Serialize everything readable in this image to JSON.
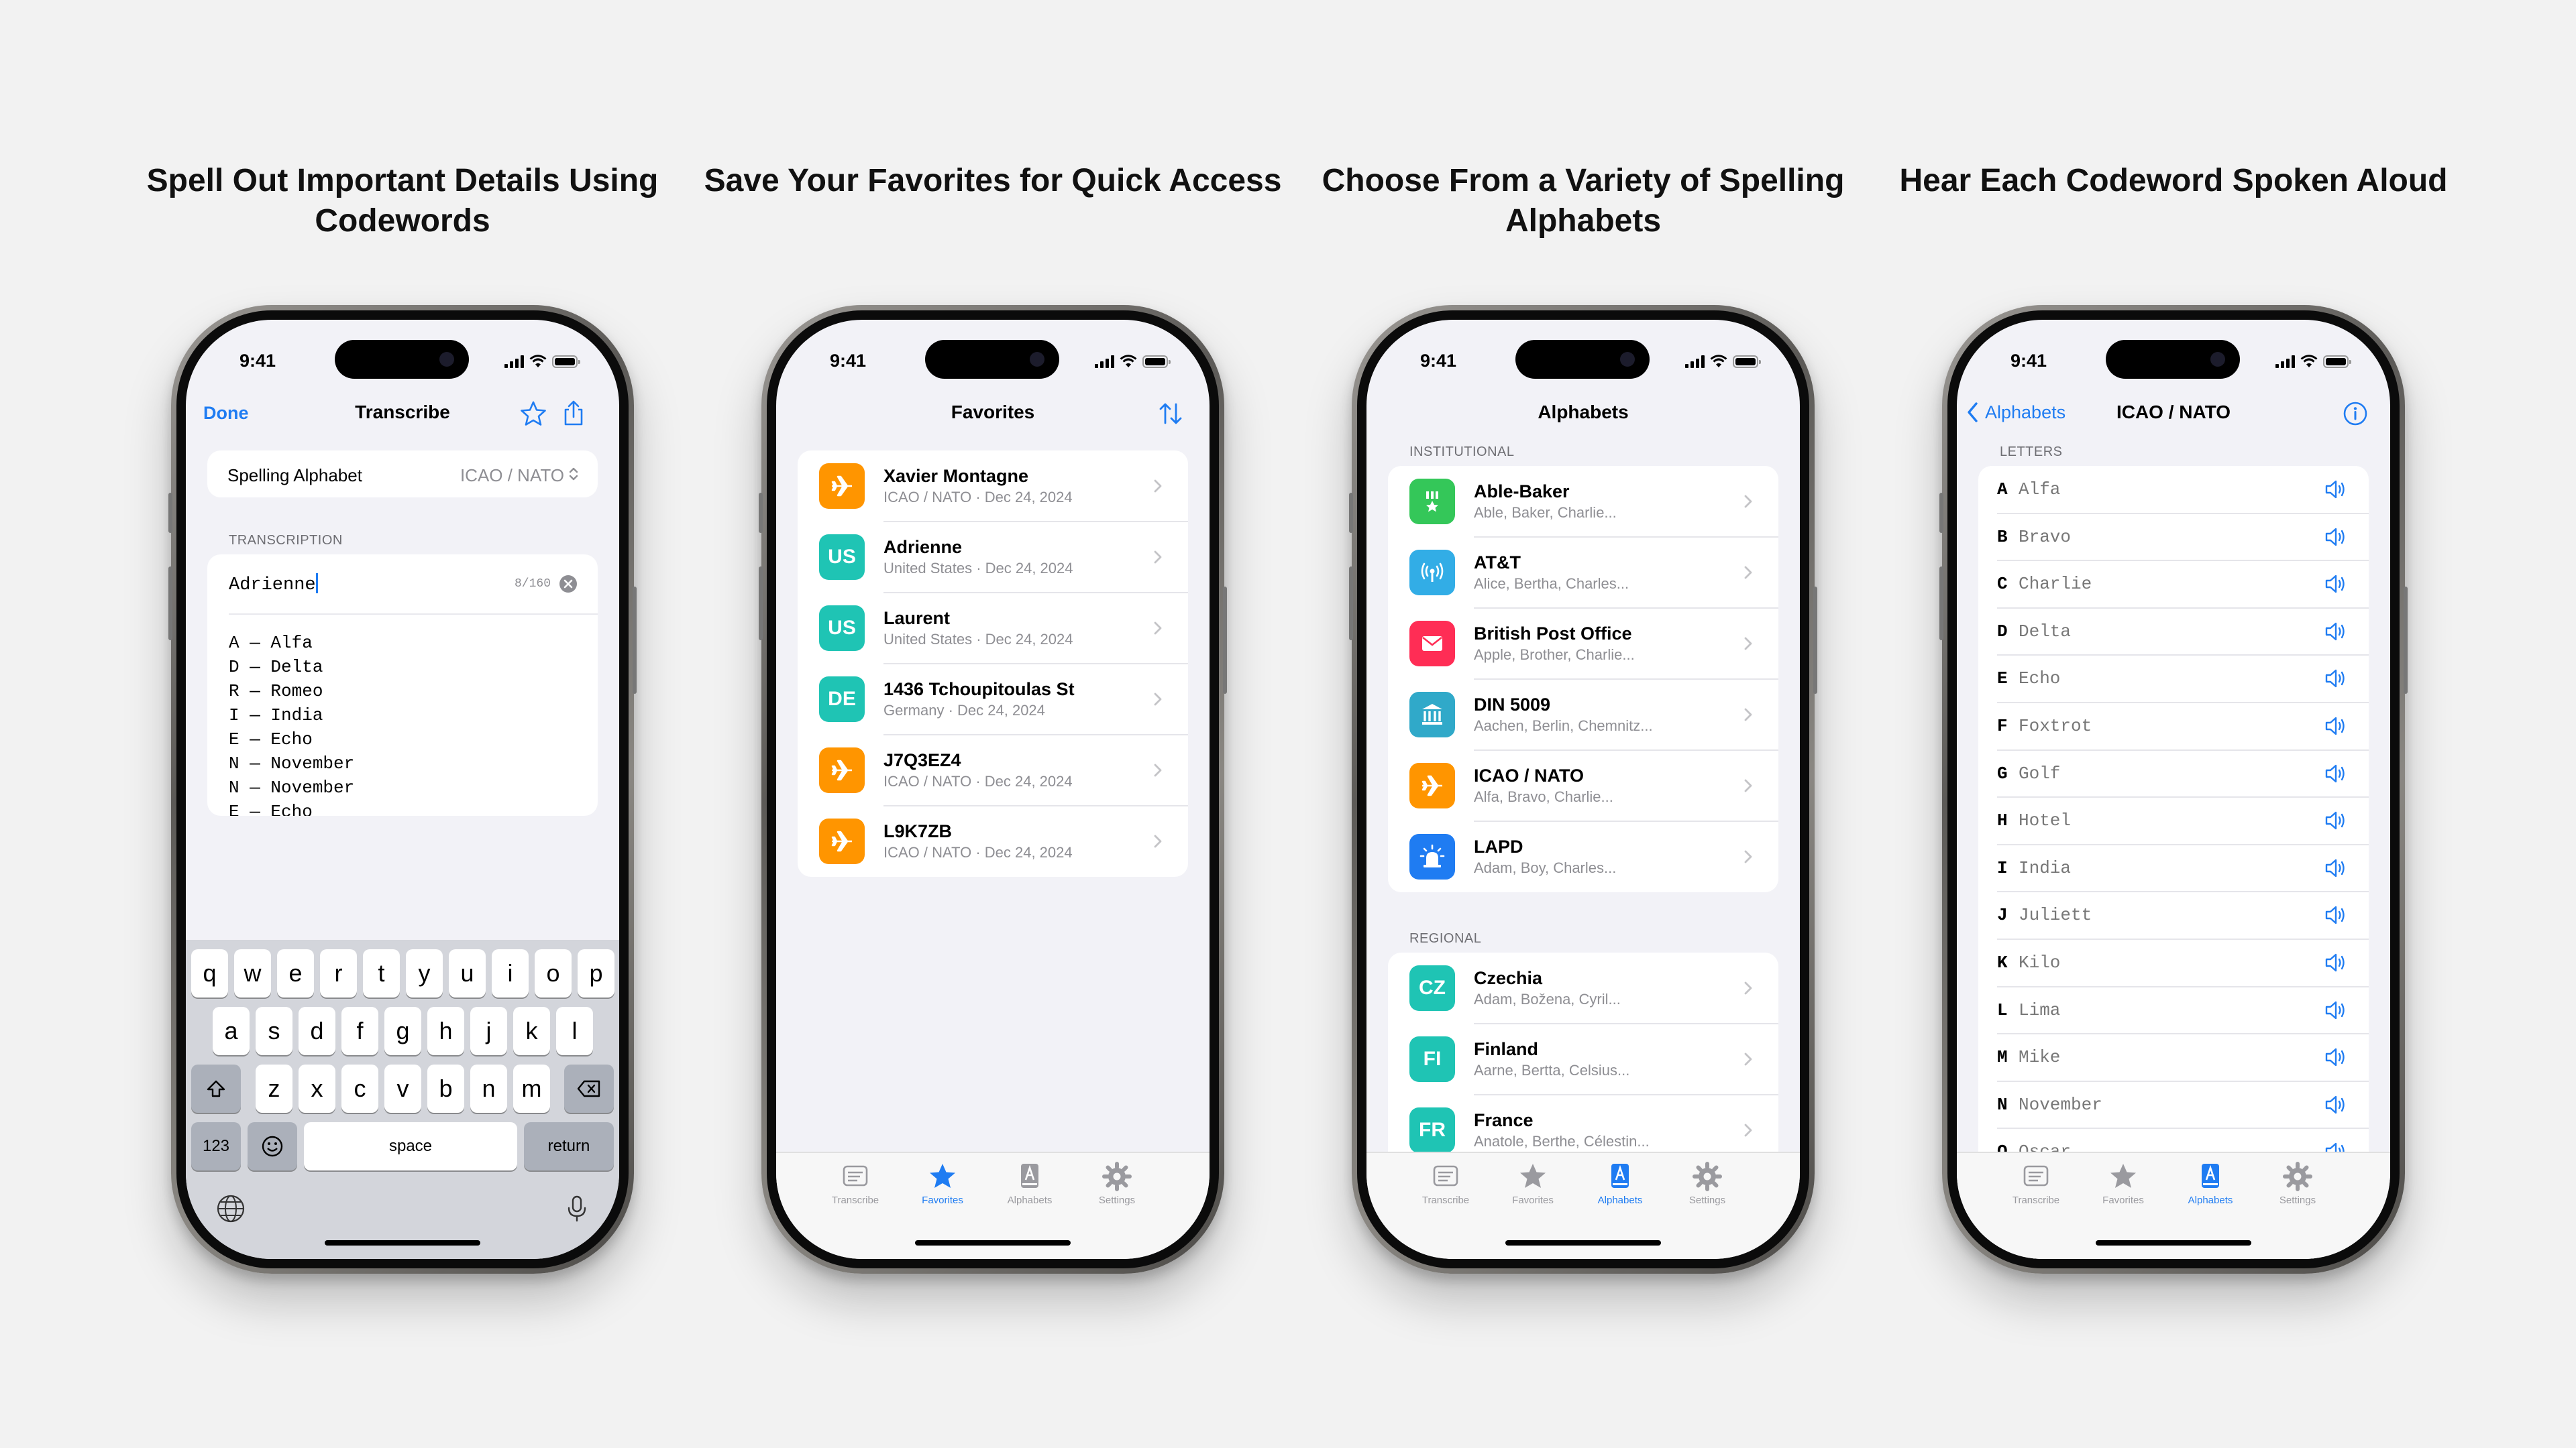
{
  "headlines": [
    "Spell Out Important Details Using Codewords",
    "Save Your Favorites for Quick Access",
    "Choose From a Variety of Spelling Alphabets",
    "Hear Each Codeword Spoken Aloud"
  ],
  "status_time": "9:41",
  "tabs": [
    "Transcribe",
    "Favorites",
    "Alphabets",
    "Settings"
  ],
  "colors": {
    "accent": "#1f7cf2",
    "orange": "#ff9500",
    "teal": "#1fc4b4",
    "green": "#34c759",
    "red": "#ff2d55",
    "sky": "#32ade6"
  },
  "transcribe": {
    "done": "Done",
    "title": "Transcribe",
    "alphabet_label": "Spelling Alphabet",
    "alphabet_value": "ICAO / NATO",
    "section": "TRANSCRIPTION",
    "input_value": "Adrienne",
    "char_count": "8/160",
    "lines": [
      "A — Alfa",
      "D — Delta",
      "R — Romeo",
      "I — India",
      "E — Echo",
      "N — November",
      "N — November",
      "E — Echo"
    ],
    "keyboard": {
      "row1": [
        "q",
        "w",
        "e",
        "r",
        "t",
        "y",
        "u",
        "i",
        "o",
        "p"
      ],
      "row2": [
        "a",
        "s",
        "d",
        "f",
        "g",
        "h",
        "j",
        "k",
        "l"
      ],
      "row3": [
        "z",
        "x",
        "c",
        "v",
        "b",
        "n",
        "m"
      ],
      "num": "123",
      "space": "space",
      "return": "return"
    }
  },
  "favorites": {
    "title": "Favorites",
    "items": [
      {
        "icon": "airplane-icon",
        "badge": "",
        "color": "#ff9500",
        "title": "Xavier Montagne",
        "sub": "ICAO / NATO · Dec 24, 2024"
      },
      {
        "icon": "badge",
        "badge": "US",
        "color": "#1fc4b4",
        "title": "Adrienne",
        "sub": "United States · Dec 24, 2024"
      },
      {
        "icon": "badge",
        "badge": "US",
        "color": "#1fc4b4",
        "title": "Laurent",
        "sub": "United States · Dec 24, 2024"
      },
      {
        "icon": "badge",
        "badge": "DE",
        "color": "#1fc4b4",
        "title": "1436 Tchoupitoulas St",
        "sub": "Germany · Dec 24, 2024"
      },
      {
        "icon": "airplane-icon",
        "badge": "",
        "color": "#ff9500",
        "title": "J7Q3EZ4",
        "sub": "ICAO / NATO · Dec 24, 2024"
      },
      {
        "icon": "airplane-icon",
        "badge": "",
        "color": "#ff9500",
        "title": "L9K7ZB",
        "sub": "ICAO / NATO · Dec 24, 2024"
      }
    ]
  },
  "alphabets": {
    "title": "Alphabets",
    "section1": "INSTITUTIONAL",
    "section2": "REGIONAL",
    "institutional": [
      {
        "icon": "medal-icon",
        "badge": "",
        "color": "#34c759",
        "title": "Able-Baker",
        "sub": "Able, Baker, Charlie..."
      },
      {
        "icon": "antenna-icon",
        "badge": "",
        "color": "#32ade6",
        "title": "AT&T",
        "sub": "Alice, Bertha, Charles..."
      },
      {
        "icon": "envelope-icon",
        "badge": "",
        "color": "#ff2d55",
        "title": "British Post Office",
        "sub": "Apple, Brother, Charlie..."
      },
      {
        "icon": "building-icon",
        "badge": "",
        "color": "#30a9c9",
        "title": "DIN 5009",
        "sub": "Aachen, Berlin, Chemnitz..."
      },
      {
        "icon": "airplane-icon",
        "badge": "",
        "color": "#ff9500",
        "title": "ICAO / NATO",
        "sub": "Alfa, Bravo, Charlie..."
      },
      {
        "icon": "siren-icon",
        "badge": "",
        "color": "#1f7cf2",
        "title": "LAPD",
        "sub": "Adam, Boy, Charles..."
      }
    ],
    "regional": [
      {
        "icon": "badge",
        "badge": "CZ",
        "color": "#1fc4b4",
        "title": "Czechia",
        "sub": "Adam, Božena, Cyril..."
      },
      {
        "icon": "badge",
        "badge": "FI",
        "color": "#1fc4b4",
        "title": "Finland",
        "sub": "Aarne, Bertta, Celsius..."
      },
      {
        "icon": "badge",
        "badge": "FR",
        "color": "#1fc4b4",
        "title": "France",
        "sub": "Anatole, Berthe, Célestin..."
      }
    ]
  },
  "nato": {
    "back": "Alphabets",
    "title": "ICAO / NATO",
    "section": "LETTERS",
    "letters": [
      {
        "l": "A",
        "w": "Alfa"
      },
      {
        "l": "B",
        "w": "Bravo"
      },
      {
        "l": "C",
        "w": "Charlie"
      },
      {
        "l": "D",
        "w": "Delta"
      },
      {
        "l": "E",
        "w": "Echo"
      },
      {
        "l": "F",
        "w": "Foxtrot"
      },
      {
        "l": "G",
        "w": "Golf"
      },
      {
        "l": "H",
        "w": "Hotel"
      },
      {
        "l": "I",
        "w": "India"
      },
      {
        "l": "J",
        "w": "Juliett"
      },
      {
        "l": "K",
        "w": "Kilo"
      },
      {
        "l": "L",
        "w": "Lima"
      },
      {
        "l": "M",
        "w": "Mike"
      },
      {
        "l": "N",
        "w": "November"
      },
      {
        "l": "O",
        "w": "Oscar"
      }
    ]
  }
}
